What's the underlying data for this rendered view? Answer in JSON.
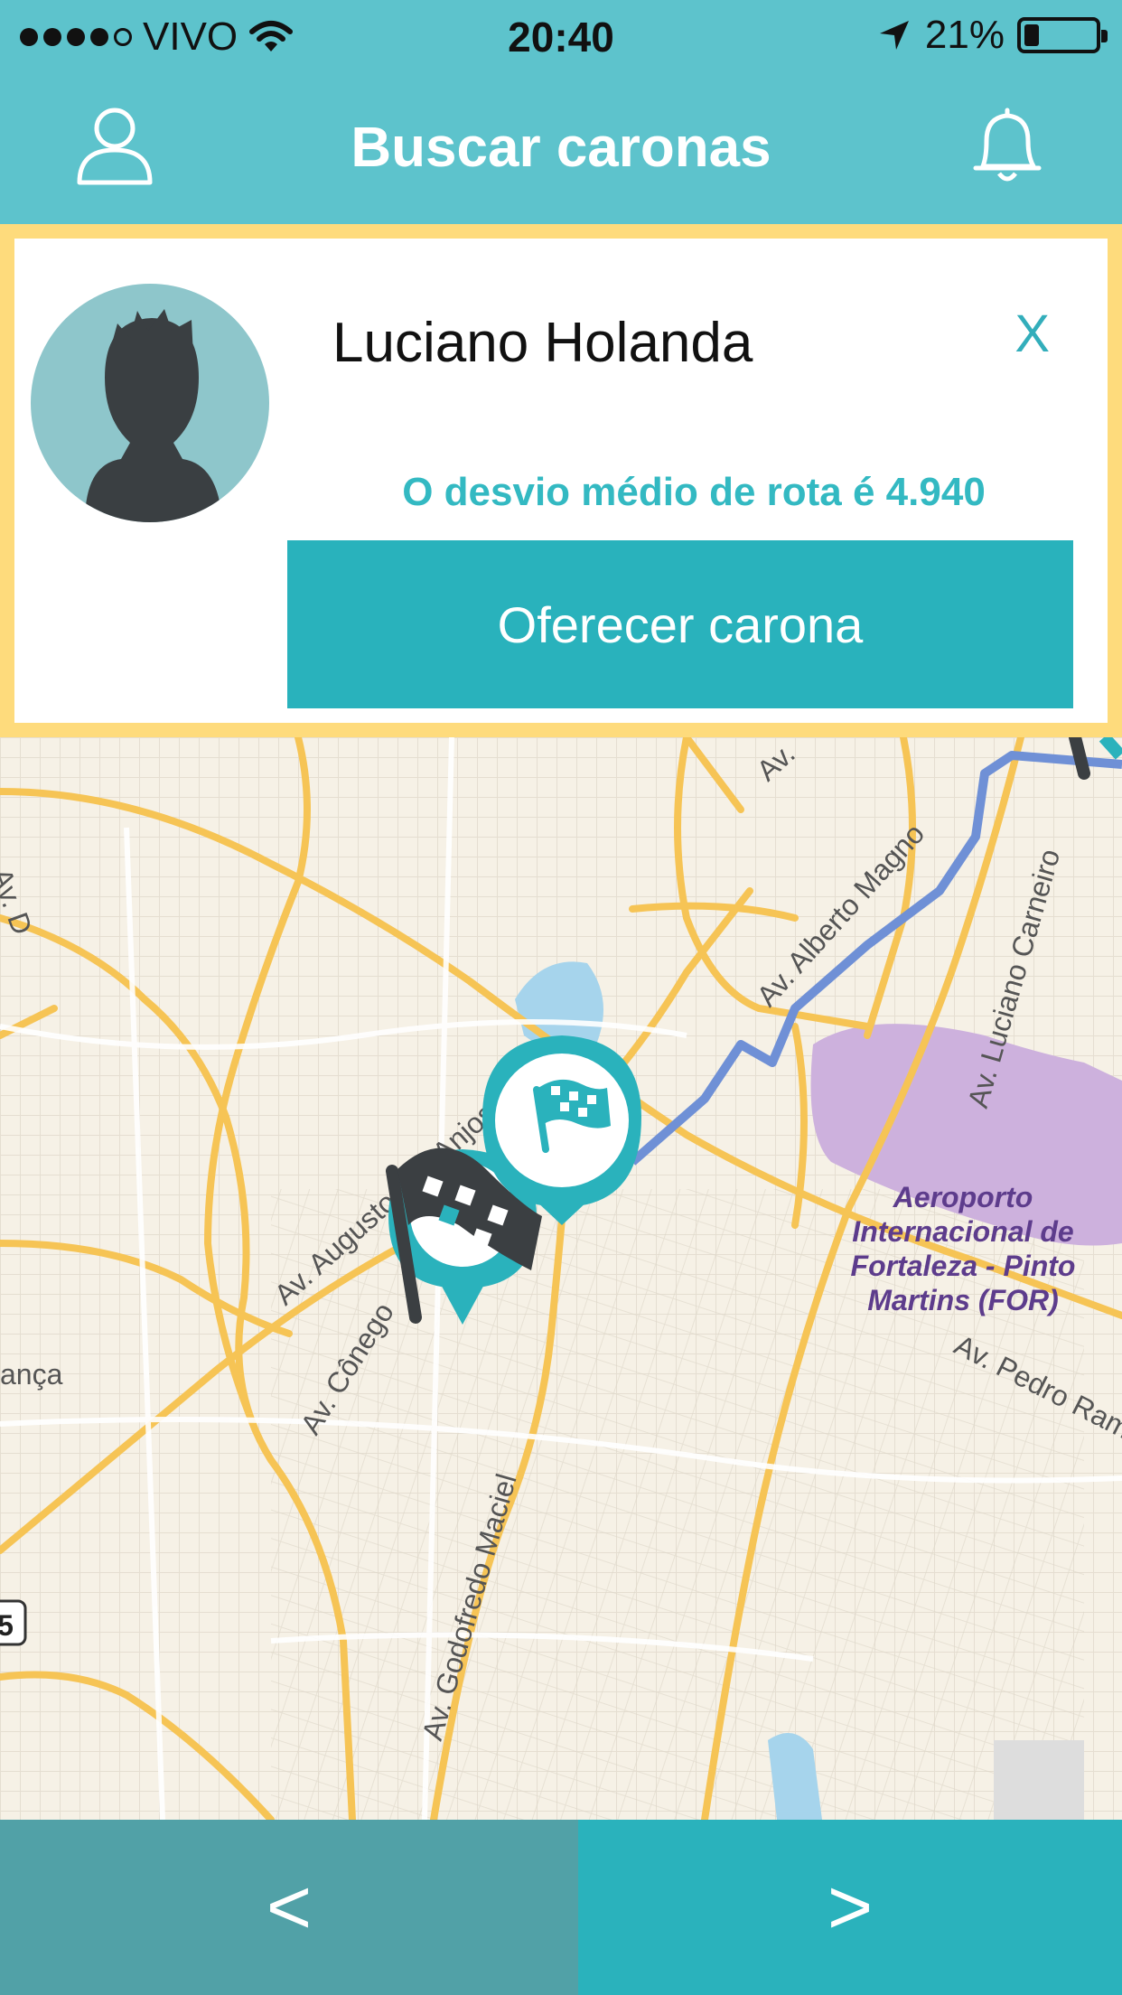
{
  "status_bar": {
    "carrier": "VIVO",
    "time": "20:40",
    "battery": "21%",
    "battery_level": 0.21,
    "signal_bars": 4,
    "signal_total": 5
  },
  "navbar": {
    "title": "Buscar caronas"
  },
  "card": {
    "driver_name": "Luciano Holanda",
    "close_label": "X",
    "deviation_text": "O desvio médio de rota é 4.940",
    "offer_button": "Oferecer carona"
  },
  "map": {
    "street_labels": {
      "aug_anjos": "Av. Augusto dos Anjos",
      "conego": "Av. Cônego",
      "godofredo": "Av. Godofredo Maciel",
      "luciano": "Av. Luciano Carneiro",
      "alberto": "Av. Alberto Magno",
      "pedro": "Av. Pedro Ramalho",
      "av_top": "Av.",
      "av_left": "Av. D",
      "anca": "ança"
    },
    "poi": {
      "line1": "Aeroporto",
      "line2": "Internacional de",
      "line3": "Fortaleza - Pinto",
      "line4": "Martins (FOR)"
    },
    "route_badge": "5"
  },
  "bottom_nav": {
    "prev": "<",
    "next": ">"
  },
  "colors": {
    "header": "#5dc3cc",
    "card_border": "#fedb7c",
    "accent": "#29b2bc",
    "prev_bg": "#51a1a7",
    "route": "#6f90d6",
    "airport": "#cdb1dd"
  }
}
